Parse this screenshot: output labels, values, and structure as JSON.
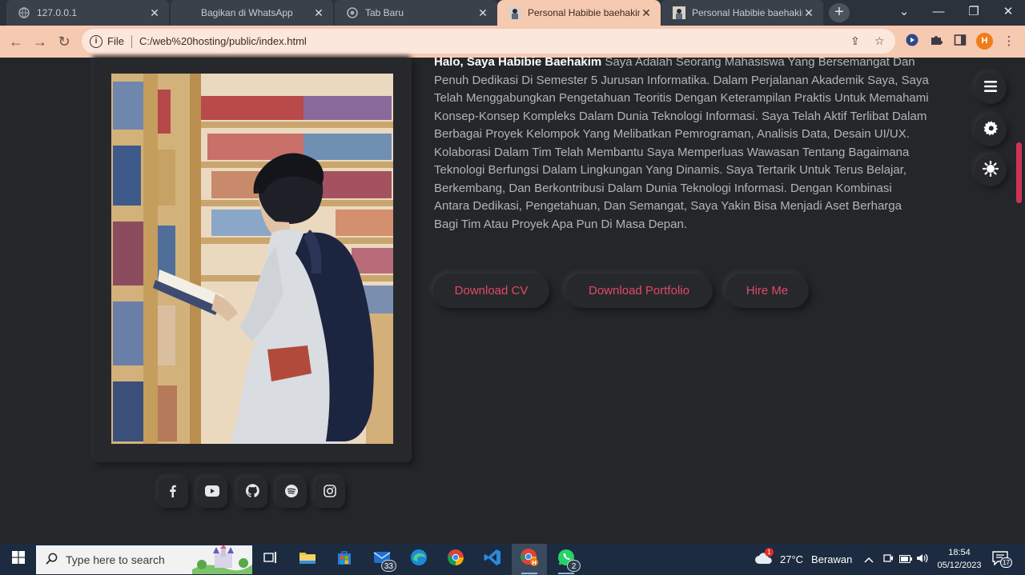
{
  "browser": {
    "tabs": [
      {
        "title": "127.0.0.1",
        "active": false
      },
      {
        "title": "Bagikan di WhatsApp",
        "active": false
      },
      {
        "title": "Tab Baru",
        "active": false
      },
      {
        "title": "Personal Habibie baehakim",
        "active": true
      },
      {
        "title": "Personal Habibie baehakim",
        "active": false
      }
    ],
    "address_label": "File",
    "address_url": "C:/web%20hosting/public/index.html",
    "profile_initial": "H"
  },
  "about": {
    "greeting": "Halo, Saya Habibie Baehakim",
    "text": " Saya Adalah Seorang Mahasiswa Yang Bersemangat Dan Penuh Dedikasi Di Semester 5 Jurusan Informatika. Dalam Perjalanan Akademik Saya, Saya Telah Menggabungkan Pengetahuan Teoritis Dengan Keterampilan Praktis Untuk Memahami Konsep-Konsep Kompleks Dalam Dunia Teknologi Informasi. Saya Telah Aktif Terlibat Dalam Berbagai Proyek Kelompok Yang Melibatkan Pemrograman, Analisis Data, Desain UI/UX. Kolaborasi Dalam Tim Telah Membantu Saya Memperluas Wawasan Tentang Bagaimana Teknologi Berfungsi Dalam Lingkungan Yang Dinamis. Saya Tertarik Untuk Terus Belajar, Berkembang, Dan Berkontribusi Dalam Dunia Teknologi Informasi. Dengan Kombinasi Antara Dedikasi, Pengetahuan, Dan Semangat, Saya Yakin Bisa Menjadi Aset Berharga Bagi Tim Atau Proyek Apa Pun Di Masa Depan."
  },
  "buttons": {
    "download_cv": "Download CV",
    "download_portfolio": "Download Portfolio",
    "hire_me": "Hire Me"
  },
  "social_icons": [
    "facebook-icon",
    "youtube-icon",
    "github-icon",
    "spotify-icon",
    "instagram-icon"
  ],
  "floating_icons": [
    "menu-icon",
    "settings-icon",
    "theme-toggle-icon"
  ],
  "taskbar": {
    "search_placeholder": "Type here to search",
    "mail_badge": "33",
    "whatsapp_badge": "2",
    "weather_temp": "27°C",
    "weather_desc": "Berawan",
    "time": "18:54",
    "date": "05/12/2023",
    "notification_count": "17"
  },
  "colors": {
    "page_background": "#25262a",
    "accent": "#e04a66",
    "chrome_frame": "#f6c9b1"
  }
}
